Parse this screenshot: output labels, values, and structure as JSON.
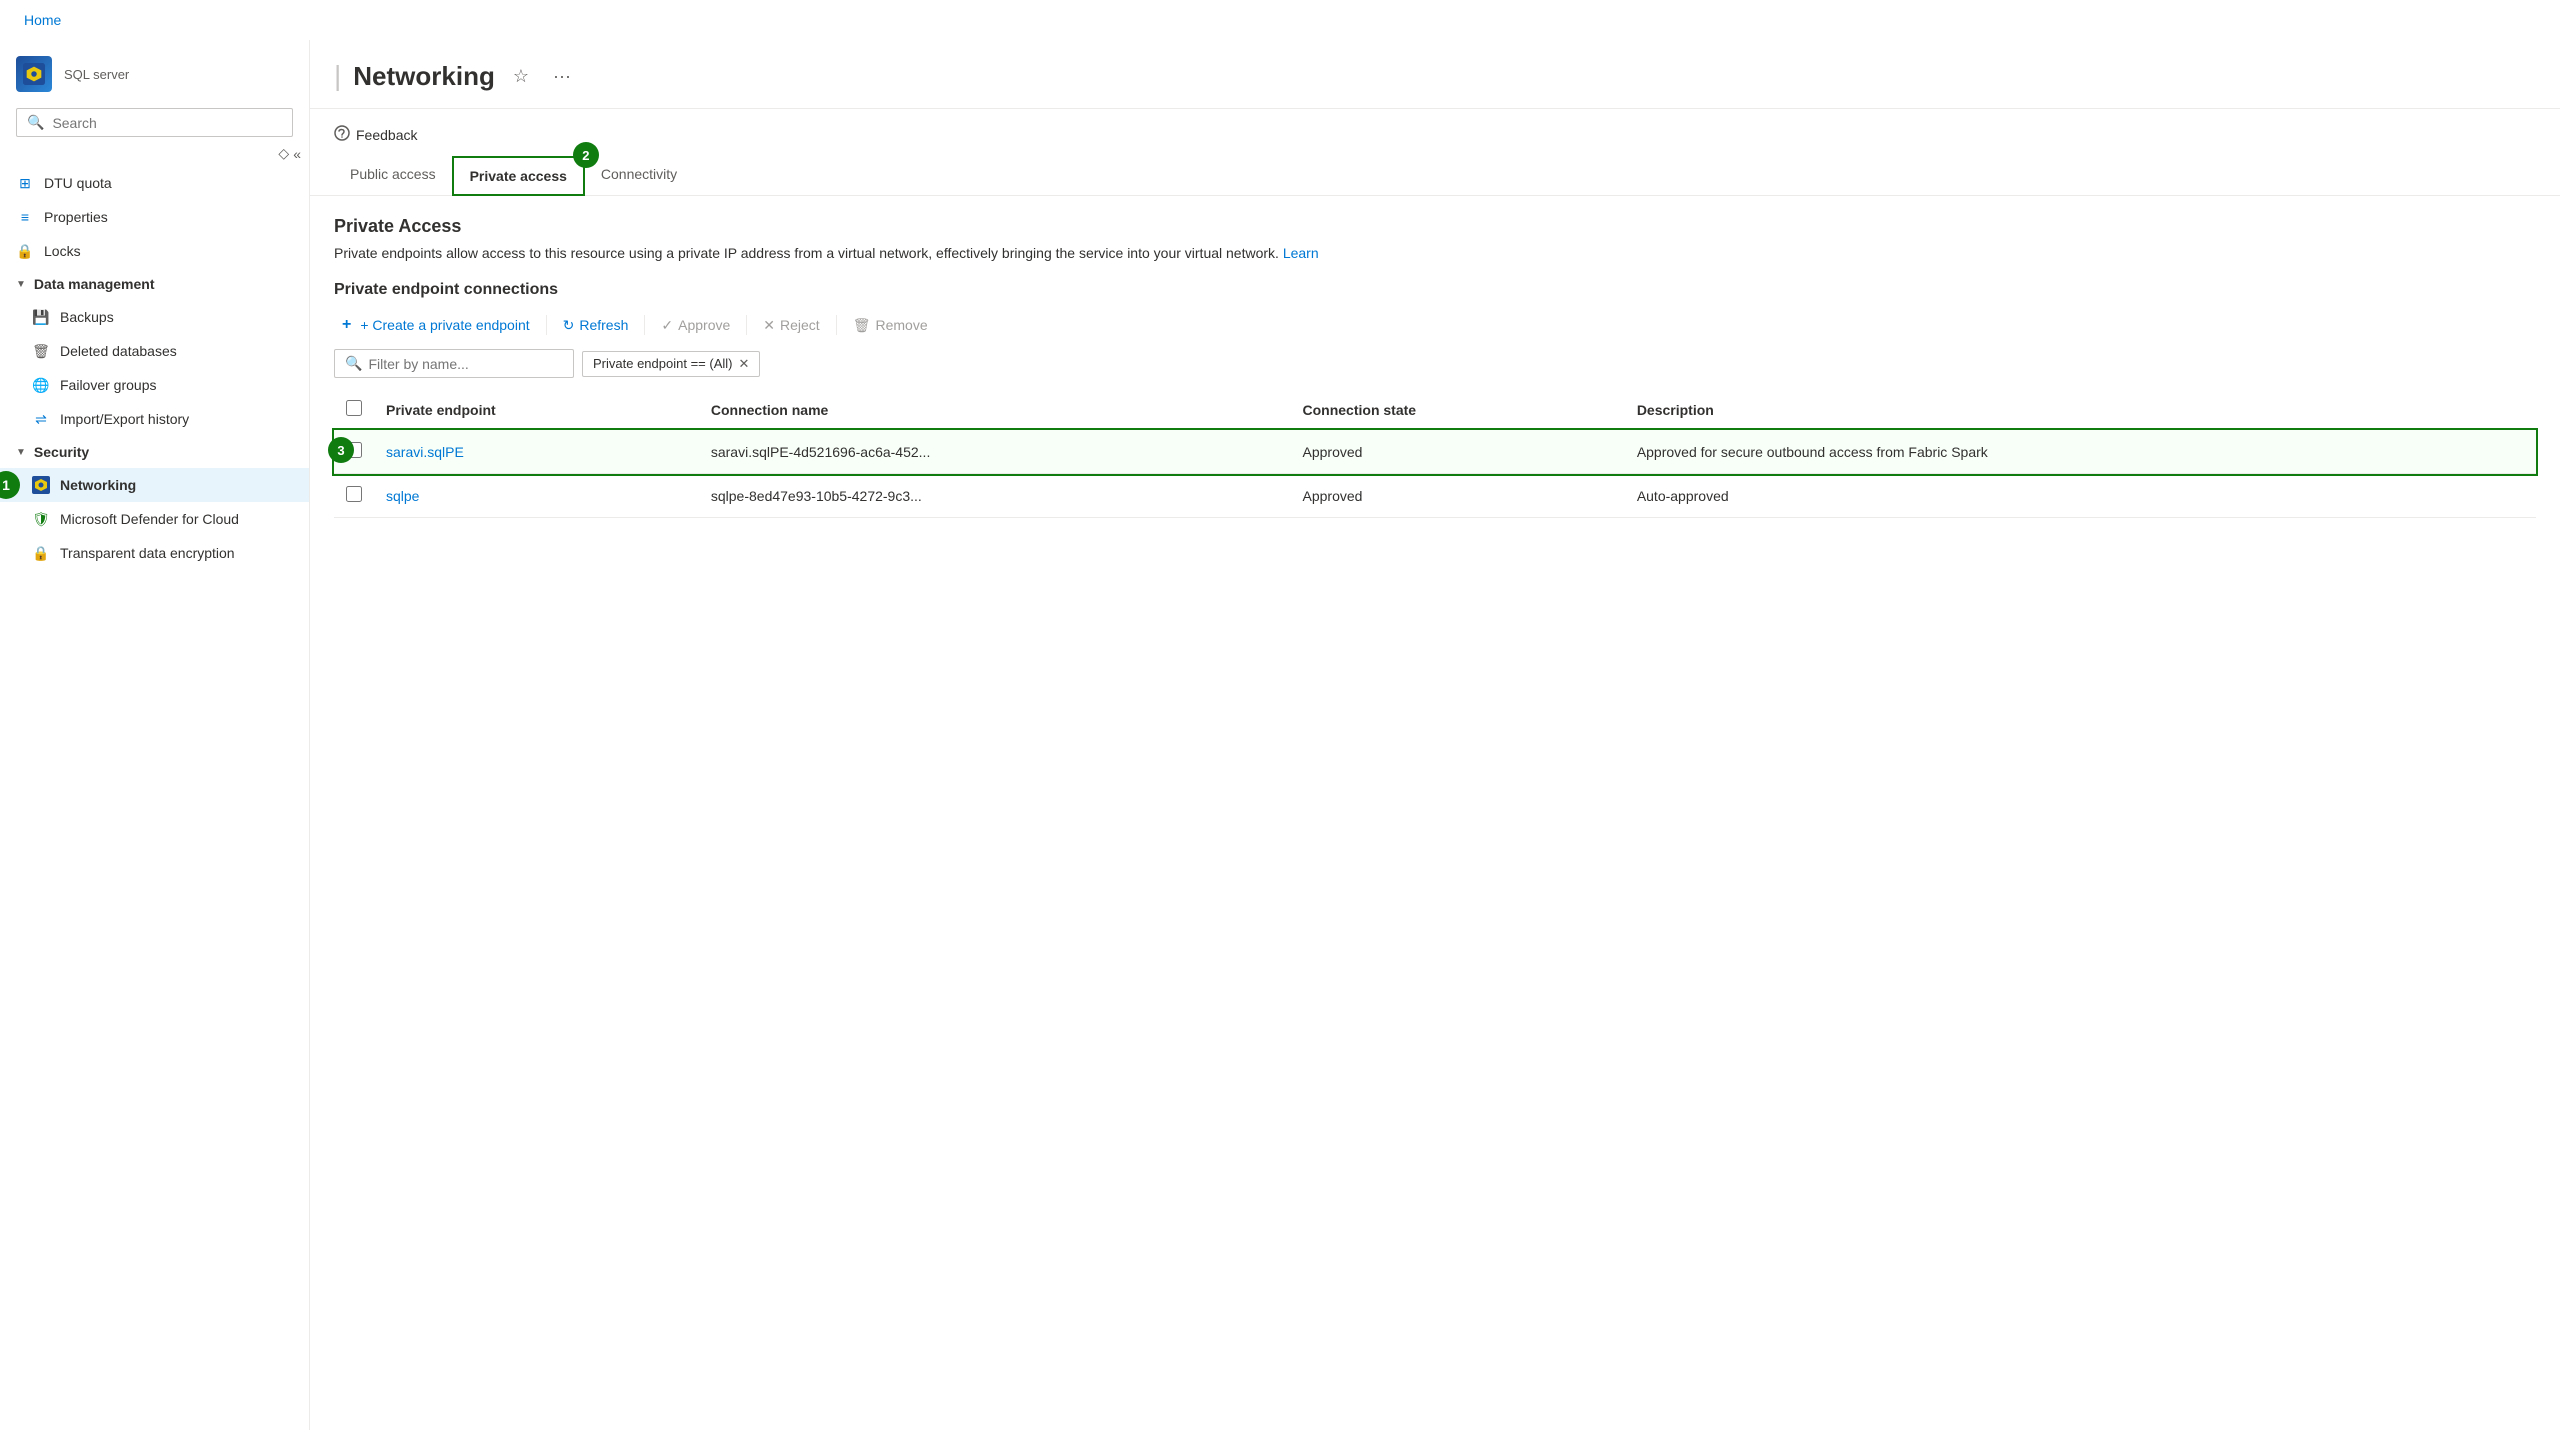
{
  "topbar": {
    "home_label": "Home"
  },
  "sidebar": {
    "resource_name": "SQL server",
    "search_placeholder": "Search",
    "nav_items": [
      {
        "id": "dtu-quota",
        "label": "DTU quota",
        "icon": "chart-icon",
        "group": null
      },
      {
        "id": "properties",
        "label": "Properties",
        "icon": "properties-icon",
        "group": null
      },
      {
        "id": "locks",
        "label": "Locks",
        "icon": "lock-icon",
        "group": null
      },
      {
        "id": "data-management",
        "label": "Data management",
        "icon": null,
        "group": "header"
      },
      {
        "id": "backups",
        "label": "Backups",
        "icon": "backup-icon",
        "group": "data-management"
      },
      {
        "id": "deleted-databases",
        "label": "Deleted databases",
        "icon": "trash-icon",
        "group": "data-management"
      },
      {
        "id": "failover-groups",
        "label": "Failover groups",
        "icon": "globe-icon",
        "group": "data-management"
      },
      {
        "id": "import-export-history",
        "label": "Import/Export history",
        "icon": "history-icon",
        "group": "data-management"
      },
      {
        "id": "security",
        "label": "Security",
        "icon": null,
        "group": "header"
      },
      {
        "id": "networking",
        "label": "Networking",
        "icon": "network-icon",
        "group": "security",
        "active": true
      },
      {
        "id": "microsoft-defender",
        "label": "Microsoft Defender for Cloud",
        "icon": "defender-icon",
        "group": "security"
      },
      {
        "id": "transparent-data-encryption",
        "label": "Transparent data encryption",
        "icon": "encryption-icon",
        "group": "security"
      }
    ]
  },
  "header": {
    "pipe": "|",
    "title": "Networking",
    "star_label": "☆",
    "more_label": "···"
  },
  "toolbar": {
    "feedback_label": "Feedback"
  },
  "tabs": [
    {
      "id": "public-access",
      "label": "Public access",
      "active": false
    },
    {
      "id": "private-access",
      "label": "Private access",
      "active": true,
      "badge": "2"
    },
    {
      "id": "connectivity",
      "label": "Connectivity",
      "active": false
    }
  ],
  "private_access": {
    "section_title": "Private Access",
    "section_desc": "Private endpoints allow access to this resource using a private IP address from a virtual network, effectively bringing the service into your virtual network.",
    "learn_more": "Learn",
    "connections_title": "Private endpoint connections",
    "actions": {
      "create": "+ Create a private endpoint",
      "refresh": "Refresh",
      "approve": "Approve",
      "reject": "Reject",
      "remove": "Remove"
    },
    "filter_placeholder": "Filter by name...",
    "filter_tag": "Private endpoint == (All)",
    "columns": [
      "Private endpoint",
      "Connection name",
      "Connection state",
      "Description"
    ],
    "rows": [
      {
        "id": "row1",
        "endpoint": "saravi.sqlPE",
        "connection_name": "saravi.sqlPE-4d521696-ac6a-452...",
        "state": "Approved",
        "description": "Approved for secure outbound access from Fabric Spark",
        "highlighted": true
      },
      {
        "id": "row2",
        "endpoint": "sqlpe",
        "connection_name": "sqlpe-8ed47e93-10b5-4272-9c3...",
        "state": "Approved",
        "description": "Auto-approved",
        "highlighted": false
      }
    ]
  },
  "badges": {
    "sidebar_networking": "1",
    "tab_private_access": "2",
    "table_row1": "3"
  }
}
